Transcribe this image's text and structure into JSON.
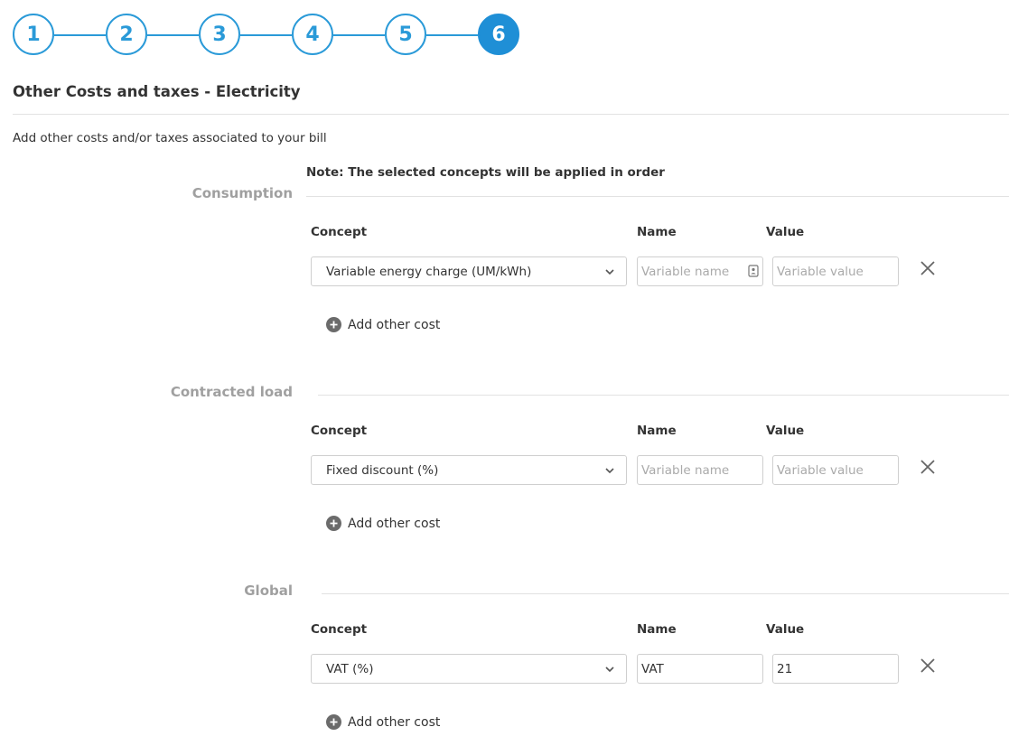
{
  "stepper": {
    "steps": [
      "1",
      "2",
      "3",
      "4",
      "5",
      "6"
    ],
    "active_step": "6"
  },
  "page": {
    "title": "Other Costs and taxes - Electricity",
    "subtitle": "Add other costs and/or taxes associated to your bill",
    "note": "Note: The selected concepts will be applied in order"
  },
  "columns": {
    "concept": "Concept",
    "name": "Name",
    "value": "Value"
  },
  "placeholders": {
    "name": "Variable name",
    "value": "Variable value"
  },
  "add_label": "Add other cost",
  "sections": [
    {
      "label": "Consumption",
      "concept": "Variable energy charge (UM/kWh)",
      "name": "",
      "value": ""
    },
    {
      "label": "Contracted load",
      "concept": "Fixed discount (%)",
      "name": "",
      "value": ""
    },
    {
      "label": "Global",
      "concept": "VAT (%)",
      "name": "VAT",
      "value": "21"
    }
  ],
  "colors": {
    "accent": "#1f8fd6",
    "section_label": "#a0a0a0"
  }
}
